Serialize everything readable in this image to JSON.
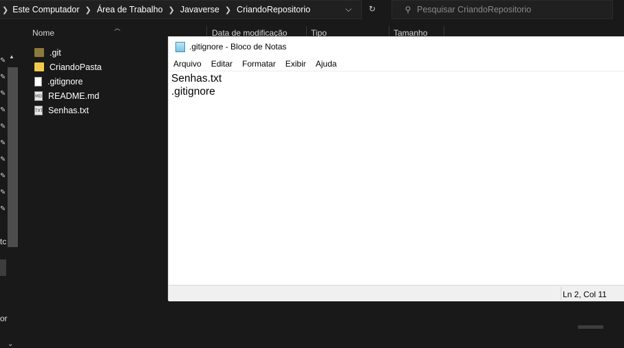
{
  "explorer": {
    "breadcrumb": [
      "Este Computador",
      "Área de Trabalho",
      "Javaverse",
      "CriandoRepositorio"
    ],
    "search_placeholder": "Pesquisar CriandoRepositorio",
    "columns": [
      "Nome",
      "Data de modificação",
      "Tipo",
      "Tamanho"
    ],
    "files": [
      {
        "name": ".git",
        "icon": "folder-icon"
      },
      {
        "name": "CriandoPasta",
        "icon": "folder-icon"
      },
      {
        "name": ".gitignore",
        "icon": "text-file-icon"
      },
      {
        "name": "README.md",
        "icon": "markdown-file-icon"
      },
      {
        "name": "Senhas.txt",
        "icon": "text-file-icon"
      }
    ],
    "edge_labels": [
      "tc",
      "or"
    ]
  },
  "notepad": {
    "title": ".gitignore - Bloco de Notas",
    "menu": [
      "Arquivo",
      "Editar",
      "Formatar",
      "Exibir",
      "Ajuda"
    ],
    "content_lines": [
      "Senhas.txt",
      ".gitignore"
    ],
    "status_position": "Ln 2, Col 11"
  },
  "colors": {
    "explorer_bg": "#191919",
    "folder": "#f2c94c",
    "notepad_bg": "#ffffff"
  }
}
